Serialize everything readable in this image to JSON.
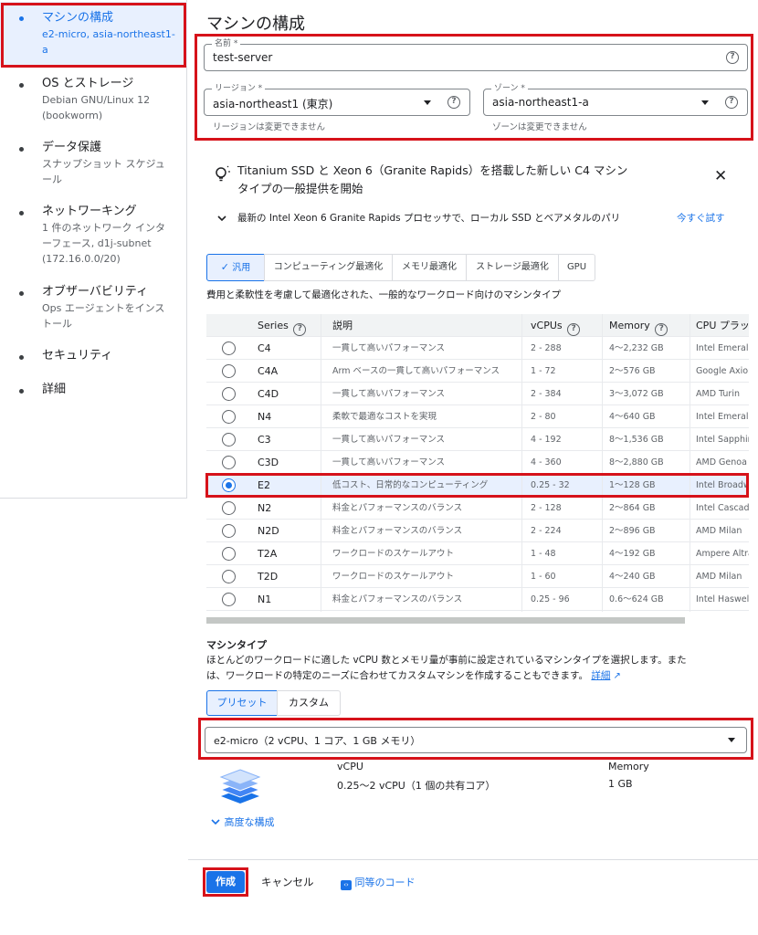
{
  "sidebar": {
    "items": [
      {
        "title": "マシンの構成",
        "sub": "e2-micro, asia-northeast1-a"
      },
      {
        "title": "OS とストレージ",
        "sub": "Debian GNU/Linux 12 (bookworm)"
      },
      {
        "title": "データ保護",
        "sub": "スナップショット スケジュール"
      },
      {
        "title": "ネットワーキング",
        "sub": "1 件のネットワーク インターフェース, d1j-subnet (172.16.0.0/20)"
      },
      {
        "title": "オブザーバビリティ",
        "sub": "Ops エージェントをインストール"
      },
      {
        "title": "セキュリティ",
        "sub": ""
      },
      {
        "title": "詳細",
        "sub": ""
      }
    ]
  },
  "main": {
    "title": "マシンの構成",
    "name_field": {
      "label": "名前 *",
      "value": "test-server"
    },
    "region_field": {
      "label": "リージョン *",
      "value": "asia-northeast1 (東京)",
      "hint": "リージョンは変更できません"
    },
    "zone_field": {
      "label": "ゾーン *",
      "value": "asia-northeast1-a",
      "hint": "ゾーンは変更できません"
    },
    "banner": {
      "title_line1": "Titanium SSD と Xeon 6（Granite Rapids）を搭載した新しい C4 マシン",
      "title_line2": "タイプの一般提供を開始",
      "detail": "最新の Intel Xeon 6 Granite Rapids プロセッサで、ローカル SSD とベアメタルのパリ",
      "action": "今すぐ試す"
    },
    "tabs": [
      "汎用",
      "コンピューティング最適化",
      "メモリ最適化",
      "ストレージ最適化",
      "GPU"
    ],
    "tab_description": "費用と柔軟性を考慮して最適化された、一般的なワークロード向けのマシンタイプ",
    "table": {
      "headers": [
        "Series",
        "説明",
        "vCPUs",
        "Memory",
        "CPU プラッ"
      ],
      "rows": [
        {
          "series": "C4",
          "desc": "一貫して高いパフォーマンス",
          "vcpus": "2 - 288",
          "memory": "4～2,232 GB",
          "cpu": "Intel Emerald"
        },
        {
          "series": "C4A",
          "desc": "Arm ベースの一貫して高いパフォーマンス",
          "vcpus": "1 - 72",
          "memory": "2～576 GB",
          "cpu": "Google Axion"
        },
        {
          "series": "C4D",
          "desc": "一貫して高いパフォーマンス",
          "vcpus": "2 - 384",
          "memory": "3～3,072 GB",
          "cpu": "AMD Turin"
        },
        {
          "series": "N4",
          "desc": "柔軟で最適なコストを実現",
          "vcpus": "2 - 80",
          "memory": "4～640 GB",
          "cpu": "Intel Emerald"
        },
        {
          "series": "C3",
          "desc": "一貫して高いパフォーマンス",
          "vcpus": "4 - 192",
          "memory": "8～1,536 GB",
          "cpu": "Intel Sapphir"
        },
        {
          "series": "C3D",
          "desc": "一貫して高いパフォーマンス",
          "vcpus": "4 - 360",
          "memory": "8～2,880 GB",
          "cpu": "AMD Genoa"
        },
        {
          "series": "E2",
          "desc": "低コスト、日常的なコンピューティング",
          "vcpus": "0.25 - 32",
          "memory": "1～128 GB",
          "cpu": "Intel Broadw"
        },
        {
          "series": "N2",
          "desc": "料金とパフォーマンスのバランス",
          "vcpus": "2 - 128",
          "memory": "2～864 GB",
          "cpu": "Intel Cascad"
        },
        {
          "series": "N2D",
          "desc": "料金とパフォーマンスのバランス",
          "vcpus": "2 - 224",
          "memory": "2～896 GB",
          "cpu": "AMD Milan"
        },
        {
          "series": "T2A",
          "desc": "ワークロードのスケールアウト",
          "vcpus": "1 - 48",
          "memory": "4～192 GB",
          "cpu": "Ampere Altra"
        },
        {
          "series": "T2D",
          "desc": "ワークロードのスケールアウト",
          "vcpus": "1 - 60",
          "memory": "4～240 GB",
          "cpu": "AMD Milan"
        },
        {
          "series": "N1",
          "desc": "料金とパフォーマンスのバランス",
          "vcpus": "0.25 - 96",
          "memory": "0.6～624 GB",
          "cpu": "Intel Haswell"
        }
      ]
    },
    "machine_type": {
      "heading": "マシンタイプ",
      "desc_line1": "ほとんどのワークロードに適した vCPU 数とメモリ量が事前に設定されているマシンタイプを選択します。また",
      "desc_line2": "は、ワークロードの特定のニーズに合わせてカスタムマシンを作成することもできます。",
      "details_link": "詳細",
      "tabs": [
        "プリセット",
        "カスタム"
      ],
      "selected": "e2-micro（2 vCPU、1 コア、1 GB メモリ）",
      "vcpu_label": "vCPU",
      "vcpu_value": "0.25～2 vCPU（1 個の共有コア）",
      "memory_label": "Memory",
      "memory_value": "1 GB"
    },
    "advanced": "高度な構成"
  },
  "footer": {
    "create": "作成",
    "cancel": "キャンセル",
    "code": "同等のコード"
  }
}
